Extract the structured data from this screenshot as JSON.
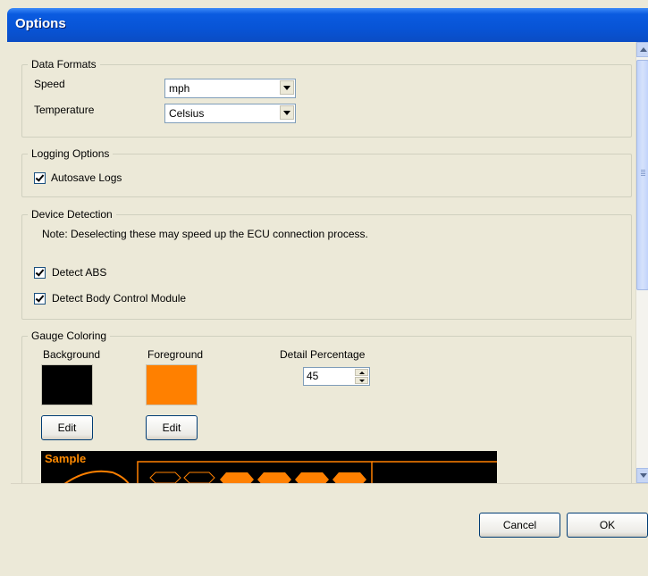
{
  "window": {
    "title": "Options"
  },
  "data_formats": {
    "legend": "Data Formats",
    "speed_label": "Speed",
    "speed_value": "mph",
    "temperature_label": "Temperature",
    "temperature_value": "Celsius"
  },
  "logging": {
    "legend": "Logging Options",
    "autosave_label": "Autosave Logs",
    "autosave_checked": true
  },
  "device_detection": {
    "legend": "Device Detection",
    "note": "Note:  Deselecting these may speed up the ECU connection process.",
    "detect_abs_label": "Detect ABS",
    "detect_abs_checked": true,
    "detect_bcm_label": "Detect Body Control Module",
    "detect_bcm_checked": true
  },
  "gauge_coloring": {
    "legend": "Gauge Coloring",
    "background_label": "Background",
    "background_color": "#000000",
    "foreground_label": "Foreground",
    "foreground_color": "#ff8000",
    "detail_label": "Detail Percentage",
    "detail_value": "45",
    "edit_label": "Edit",
    "sample_label": "Sample"
  },
  "buttons": {
    "cancel": "Cancel",
    "ok": "OK"
  }
}
